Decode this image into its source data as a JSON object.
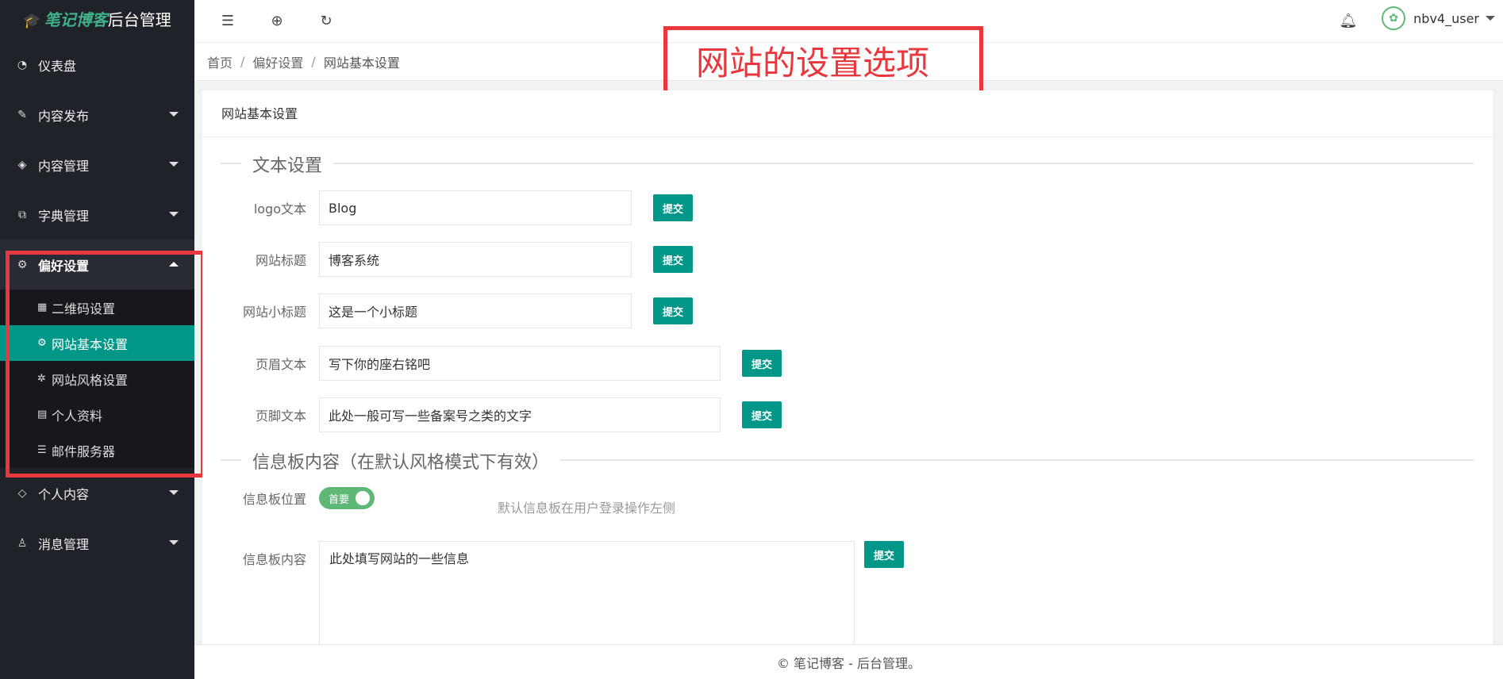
{
  "app": {
    "brand": "笔记博客",
    "title": "后台管理"
  },
  "sidebar": {
    "items": [
      {
        "label": "仪表盘",
        "icon": "dashboard-icon"
      },
      {
        "label": "内容发布",
        "icon": "pencil-icon"
      },
      {
        "label": "内容管理",
        "icon": "layers-icon"
      },
      {
        "label": "字典管理",
        "icon": "book-icon"
      },
      {
        "label": "偏好设置",
        "icon": "gear-icon"
      },
      {
        "label": "个人内容",
        "icon": "diamond-icon"
      },
      {
        "label": "消息管理",
        "icon": "user-icon"
      }
    ],
    "submenu": [
      {
        "label": "二维码设置",
        "icon": "qrcode-icon"
      },
      {
        "label": "网站基本设置",
        "icon": "cogs-icon"
      },
      {
        "label": "网站风格设置",
        "icon": "cog-icon"
      },
      {
        "label": "个人资料",
        "icon": "id-card-icon"
      },
      {
        "label": "邮件服务器",
        "icon": "server-icon"
      }
    ]
  },
  "header": {
    "username": "nbv4_user"
  },
  "breadcrumb": {
    "home": "首页",
    "section": "偏好设置",
    "current": "网站基本设置"
  },
  "annotation": {
    "text": "网站的设置选项"
  },
  "card": {
    "title": "网站基本设置",
    "text_section": "文本设置",
    "fields": [
      {
        "label": "logo文本",
        "value": "Blog",
        "button": "提交"
      },
      {
        "label": "网站标题",
        "value": "博客系统",
        "button": "提交"
      },
      {
        "label": "网站小标题",
        "value": "这是一个小标题",
        "button": "提交"
      },
      {
        "label": "页眉文本",
        "value": "写下你的座右铭吧",
        "button": "提交"
      },
      {
        "label": "页脚文本",
        "value": "此处一般可写一些备案号之类的文字",
        "button": "提交"
      }
    ],
    "board_section": "信息板内容（在默认风格模式下有效）",
    "board_position": {
      "label": "信息板位置",
      "switch_text": "首要",
      "hint": "默认信息板在用户登录操作左侧"
    },
    "board_content": {
      "label": "信息板内容",
      "value": "此处填写网站的一些信息",
      "button": "提交"
    }
  },
  "footer": {
    "text": "© 笔记博客 - 后台管理。"
  },
  "colors": {
    "sidebar_bg": "#20222a",
    "accent": "#009688",
    "switch": "#5fb878",
    "annotation": "#e8373d"
  }
}
